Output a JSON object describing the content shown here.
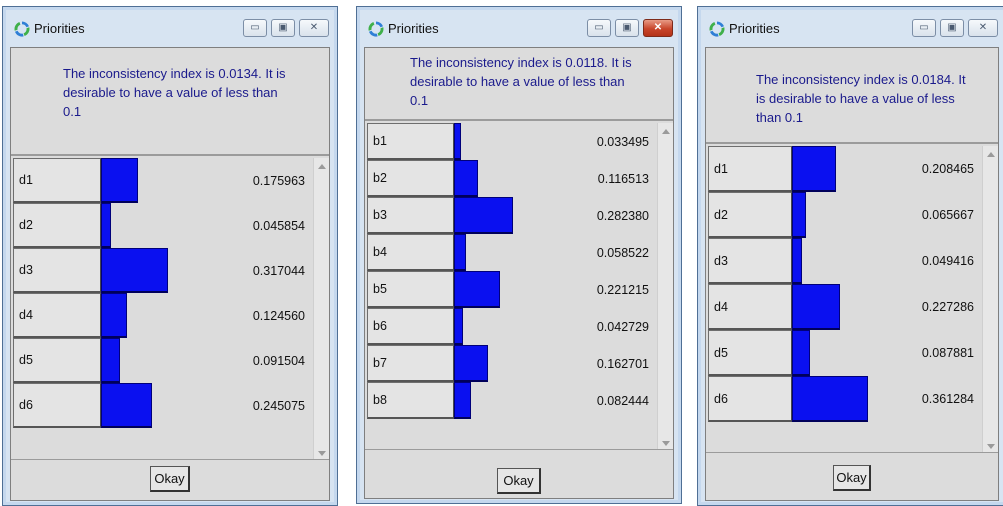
{
  "windows": [
    {
      "title": "Priorities",
      "message": "The inconsistency index is 0.0134.  It is desirable to have a value of less than 0.1",
      "items": [
        {
          "label": "d1",
          "value": "0.175963",
          "priority": 0.175963
        },
        {
          "label": "d2",
          "value": "0.045854",
          "priority": 0.045854
        },
        {
          "label": "d3",
          "value": "0.317044",
          "priority": 0.317044
        },
        {
          "label": "d4",
          "value": "0.124560",
          "priority": 0.12456
        },
        {
          "label": "d5",
          "value": "0.091504",
          "priority": 0.091504
        },
        {
          "label": "d6",
          "value": "0.245075",
          "priority": 0.245075
        }
      ],
      "okay_label": "Okay",
      "controls": [
        "minimize-icon",
        "maximize-icon",
        "close-icon"
      ]
    },
    {
      "title": "Priorities",
      "message": "The inconsistency index is 0.0118.  It is desirable to have a value of less than 0.1",
      "items": [
        {
          "label": "b1",
          "value": "0.033495",
          "priority": 0.033495
        },
        {
          "label": "b2",
          "value": "0.116513",
          "priority": 0.116513
        },
        {
          "label": "b3",
          "value": "0.282380",
          "priority": 0.28238
        },
        {
          "label": "b4",
          "value": "0.058522",
          "priority": 0.058522
        },
        {
          "label": "b5",
          "value": "0.221215",
          "priority": 0.221215
        },
        {
          "label": "b6",
          "value": "0.042729",
          "priority": 0.042729
        },
        {
          "label": "b7",
          "value": "0.162701",
          "priority": 0.162701
        },
        {
          "label": "b8",
          "value": "0.082444",
          "priority": 0.082444
        }
      ],
      "okay_label": "Okay",
      "controls": [
        "minimize-icon",
        "maximize-icon",
        "close-icon"
      ]
    },
    {
      "title": "Priorities",
      "message": "The inconsistency index is 0.0184.  It is desirable to have a value of less than 0.1",
      "items": [
        {
          "label": "d1",
          "value": "0.208465",
          "priority": 0.208465
        },
        {
          "label": "d2",
          "value": "0.065667",
          "priority": 0.065667
        },
        {
          "label": "d3",
          "value": "0.049416",
          "priority": 0.049416
        },
        {
          "label": "d4",
          "value": "0.227286",
          "priority": 0.227286
        },
        {
          "label": "d5",
          "value": "0.087881",
          "priority": 0.087881
        },
        {
          "label": "d6",
          "value": "0.361284",
          "priority": 0.361284
        }
      ],
      "okay_label": "Okay",
      "controls": [
        "minimize-icon",
        "maximize-icon",
        "close-icon"
      ]
    }
  ],
  "colors": {
    "bar_fill": "#0a10f0",
    "message_text": "#1a1a8c",
    "panel_background": "#dcdcdc",
    "window_frame": "#d7e4f2",
    "close_button_active": "#c8452b"
  }
}
